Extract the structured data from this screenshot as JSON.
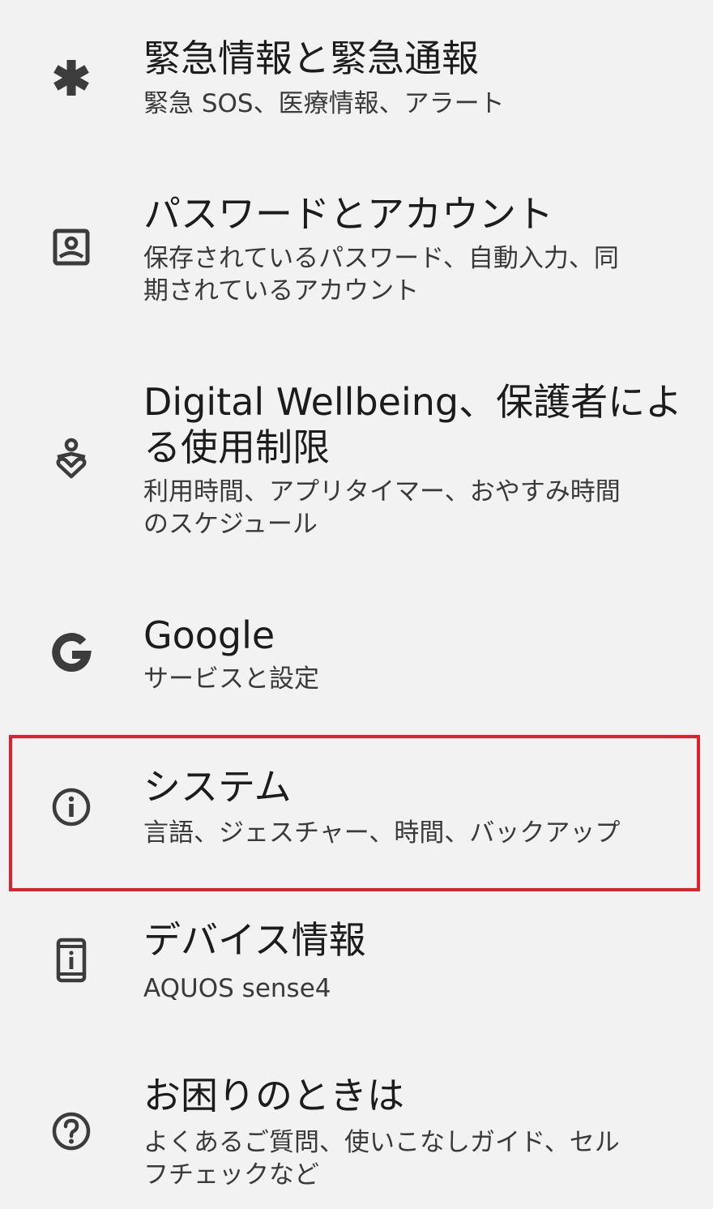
{
  "settings": {
    "items": [
      {
        "icon": "asterisk-icon",
        "title": "緊急情報と緊急通報",
        "summary": "緊急 SOS、医療情報、アラート"
      },
      {
        "icon": "account-box-icon",
        "title": "パスワードとアカウント",
        "summary": "保存されているパスワード、自動入力、同\n期されているアカウント"
      },
      {
        "icon": "digital-wellbeing-icon",
        "title": "Digital Wellbeing、保護者によ\nる使用制限",
        "summary": "利用時間、アプリタイマー、おやすみ時間\nのスケジュール"
      },
      {
        "icon": "google-g-icon",
        "title": "Google",
        "summary": "サービスと設定"
      },
      {
        "icon": "info-circle-icon",
        "title": "システム",
        "summary": "言語、ジェスチャー、時間、バックアップ"
      },
      {
        "icon": "phone-info-icon",
        "title": "デバイス情報",
        "summary": "AQUOS sense4"
      },
      {
        "icon": "help-circle-icon",
        "title": "お困りのときは",
        "summary": "よくあるご質問、使いこなしガイド、セル\nフチェックなど"
      }
    ]
  },
  "colors": {
    "background": "#f2f2f2",
    "icon": "#3c3c3c",
    "highlight_border": "#e0202a"
  }
}
